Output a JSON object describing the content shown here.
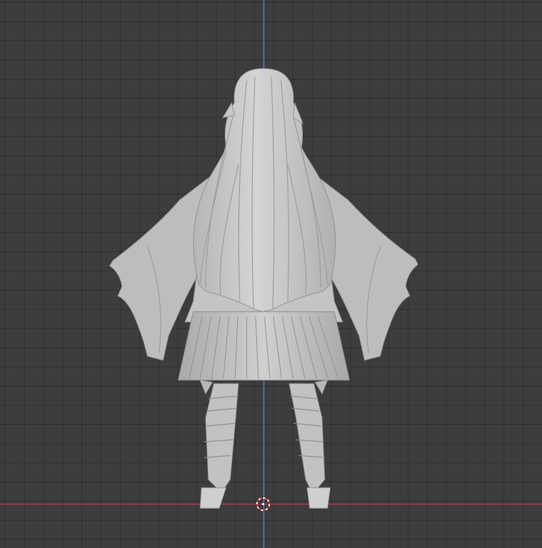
{
  "viewport": {
    "view": "back-orthographic",
    "background_color": "#3d3d3d",
    "grid": true,
    "axis_colors": {
      "x_axis": "#9a3448",
      "z_axis": "#3f6fb8"
    }
  },
  "model": {
    "subject": "character-mesh-back-view",
    "shading": "solid",
    "color": "#c8c8c8"
  },
  "cursor_icon": "3d-cursor-icon"
}
